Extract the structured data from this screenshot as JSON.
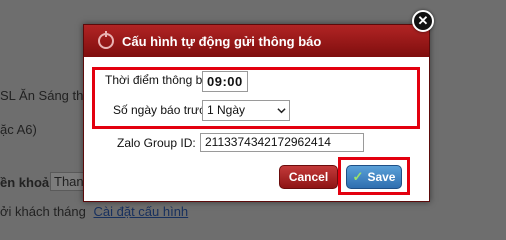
{
  "background": {
    "row1_text": "SL Ăn Sáng theo",
    "row2_text": "ặc A6)",
    "row3_label": "ền khoản:",
    "row3_value": "Thanh",
    "row4_text": "ởi khách tháng",
    "row4_link": "Cài đặt cấu hình"
  },
  "dialog": {
    "title": "Cấu hình tự động gửi thông báo",
    "close_symbol": "✕",
    "notify_time_label": "Thời điểm thông báo:",
    "notify_time_value": "09:00",
    "days_before_label": "Số ngày báo trước:",
    "days_before_value": "1 Ngày",
    "zalo_group_label": "Zalo Group ID:",
    "zalo_group_value": "2113374342172962414",
    "cancel_label": "Cancel",
    "save_label": "Save",
    "save_icon": "✓"
  },
  "colors": {
    "title_bar": "#9b1b1b",
    "highlight": "#e3000f",
    "cancel": "#a82020",
    "save": "#3f82c4"
  }
}
